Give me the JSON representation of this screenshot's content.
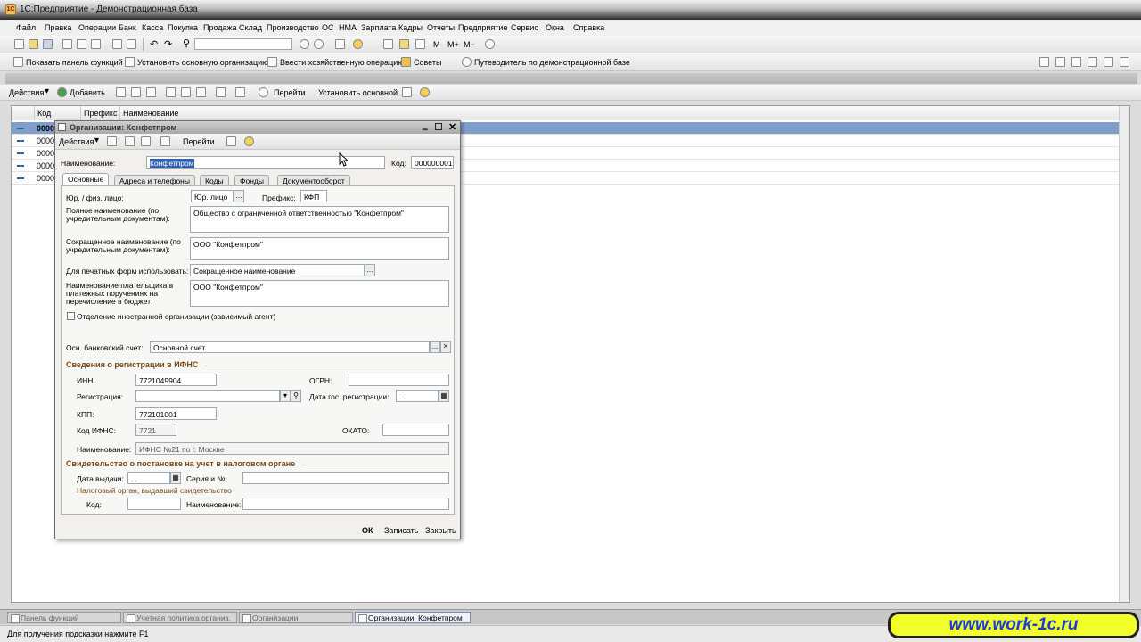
{
  "window": {
    "title": "1С:Предприятие - Демонстрационная база"
  },
  "menu": [
    "Файл",
    "Правка",
    "Операции",
    "Банк",
    "Касса",
    "Покупка",
    "Продажа",
    "Склад",
    "Производство",
    "ОС",
    "НМА",
    "Зарплата",
    "Кадры",
    "Отчеты",
    "Предприятие",
    "Сервис",
    "Окна",
    "Справка"
  ],
  "toolbar2": {
    "show_panel": "Показать панель функций",
    "set_org": "Установить основную организацию",
    "enter_op": "Ввести хозяйственную операцию",
    "tips": "Советы",
    "guide": "Путеводитель по демонстрационной базе"
  },
  "list_toolbar": {
    "actions": "Действия",
    "add": "Добавить",
    "goto": "Перейти",
    "set_main": "Установить основной"
  },
  "list": {
    "headers": [
      "Код",
      "Префикс",
      "Наименование"
    ],
    "rows": [
      "0000",
      "0000",
      "0000",
      "0000",
      "0000"
    ]
  },
  "dialog": {
    "title": "Организации: Конфетпром",
    "actions": "Действия",
    "goto": "Перейти",
    "name_label": "Наименование:",
    "name_value": "Конфетпром",
    "code_label": "Код:",
    "code_value": "000000001",
    "tabs": [
      "Основные",
      "Адреса и телефоны",
      "Коды",
      "Фонды",
      "Документооборот"
    ],
    "entity_label": "Юр. / физ. лицо:",
    "entity_value": "Юр. лицо",
    "prefix_label": "Префикс:",
    "prefix_value": "КФП",
    "full_name_label": "Полное наименование (по учредительным документам):",
    "full_name_value": "Общество с ограниченной ответственностью \"Конфетпром\"",
    "short_name_label": "Сокращенное наименование (по учредительным документам):",
    "short_name_value": "ООО \"Конфетпром\"",
    "print_label": "Для печатных форм использовать:",
    "print_value": "Сокращенное наименование",
    "payer_label": "Наименование плательщика в платежных поручениях на перечисление в бюджет:",
    "payer_value": "ООО \"Конфетпром\"",
    "foreign_label": "Отделение иностранной организации (зависимый агент)",
    "bank_label": "Осн. банковский счет:",
    "bank_value": "Основной счет",
    "fns_section": "Сведения о регистрации в ИФНС",
    "inn_label": "ИНН:",
    "inn_value": "7721049904",
    "ogrn_label": "ОГРН:",
    "reg_label": "Регистрация:",
    "reg_date_label": "Дата гос. регистрации:",
    "reg_date_value": ". .",
    "kpp_label": "КПП:",
    "kpp_value": "772101001",
    "fns_code_label": "Код ИФНС:",
    "fns_code_value": "7721",
    "okato_label": "ОКАТО:",
    "fns_name_label": "Наименование:",
    "fns_name_value": "ИФНС №21 по г. Москве",
    "cert_section": "Свидетельство о постановке на учет в налоговом органе",
    "issue_date_label": "Дата выдачи:",
    "issue_date_value": ". .",
    "series_label": "Серия и №:",
    "issuer_label": "Налоговый орган, выдавший свидетельство",
    "issuer_code_label": "Код:",
    "issuer_name_label": "Наименование:",
    "ok": "ОК",
    "save": "Записать",
    "close": "Закрыть"
  },
  "taskbar": [
    "Панель функций",
    "Учетная политика организ.",
    "Организации",
    "Организации: Конфетпром"
  ],
  "status": "Для получения подсказки нажмите F1",
  "promo": "www.work-1c.ru"
}
